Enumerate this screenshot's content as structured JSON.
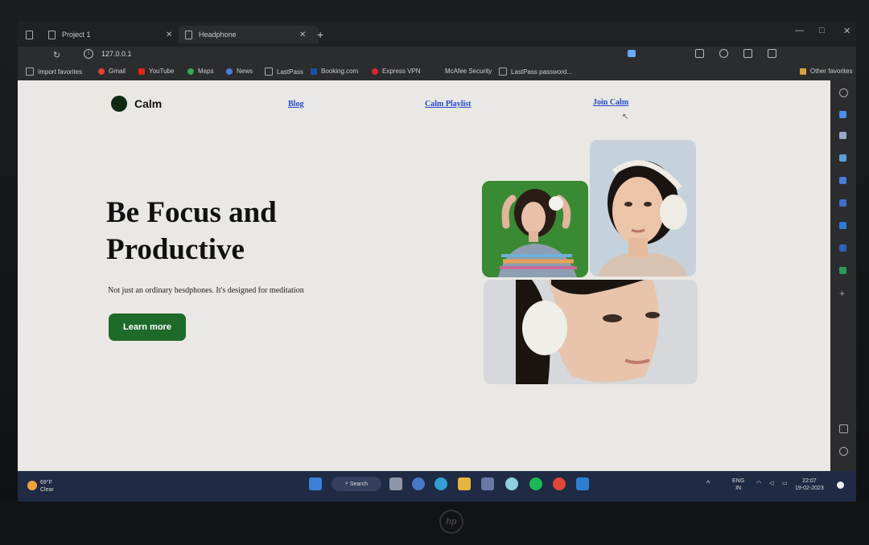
{
  "browser": {
    "tabs": [
      {
        "title": "Project 1"
      },
      {
        "title": "Headphone"
      }
    ],
    "new_tab_glyph": "+",
    "url": "127.0.0.1",
    "bookmarks": [
      {
        "label": "Import favorites"
      },
      {
        "label": "Gmail"
      },
      {
        "label": "YouTube"
      },
      {
        "label": "Maps"
      },
      {
        "label": "News"
      },
      {
        "label": "LastPass"
      },
      {
        "label": "Booking.com"
      },
      {
        "label": "Express VPN"
      },
      {
        "label": "McAfee Security"
      },
      {
        "label": "LastPass password..."
      },
      {
        "label": "Other favorites"
      }
    ]
  },
  "site": {
    "brand": "Calm",
    "nav": [
      "Blog",
      "Calm Playlist",
      "Join Calm"
    ],
    "headline_line1": "Be Focus and",
    "headline_line2": "Productive",
    "subtitle": "Not just an ordinary hesdphones. It's designed for meditation",
    "cta": "Learn more",
    "colors": {
      "accent": "#1e6a2a",
      "link": "#2549c9",
      "background": "#e9e8e4"
    }
  },
  "taskbar": {
    "weather_temp": "69°F",
    "weather_desc": "Clear",
    "search_label": "Search",
    "lang_line1": "ENG",
    "lang_line2": "IN",
    "time": "22:07",
    "date": "19-02-2023"
  },
  "device": {
    "logo": "hp"
  }
}
